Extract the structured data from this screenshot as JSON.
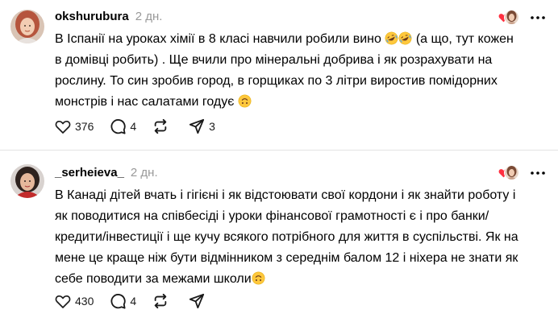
{
  "posts": [
    {
      "username": "okshurubura",
      "time": "2 дн.",
      "lines": [
        "В Іспанії на уроках хімії в 8 класі навчили робили вино",
        "(а що, тут кожен",
        "в домівці робить) . Ще вчили про мінеральні добрива і як розрахувати на",
        "рослину. То син зробив город, в горщиках по 3 літри виростив помідорних",
        "монстрів і нас салатами годує"
      ],
      "likes": "376",
      "replies": "4",
      "reposts": "",
      "shares": "3",
      "icons": {
        "avatar": "avatar-red-hair",
        "like": "heart-outline-icon",
        "reply": "speech-bubble-icon",
        "repost": "repost-arrows-icon",
        "share": "paper-plane-icon",
        "more": "more-horizontal-icon",
        "emoji_laugh": "rolling-on-floor-laughing-emoji",
        "emoji_upside": "upside-down-face-emoji"
      }
    },
    {
      "username": "_serheieva_",
      "time": "2 дн.",
      "lines": [
        "В Канаді дітей вчать і гігієні і як відстоювати свої кордони і як знайти роботу і",
        "як поводитися на співбесіді і уроки фінансової грамотності є і про банки/",
        "кредити/інвестиції і ще кучу всякого потрібного для життя в суспільстві. Як на",
        "мене це краще ніж бути відмінником з середнім балом 12 і ніхера не знати як",
        "себе поводити за межами школи"
      ],
      "likes": "430",
      "replies": "4",
      "reposts": "",
      "shares": "",
      "icons": {
        "avatar": "avatar-dark-hair",
        "like": "heart-outline-icon",
        "reply": "speech-bubble-icon",
        "repost": "repost-arrows-icon",
        "share": "paper-plane-icon",
        "more": "more-horizontal-icon",
        "emoji_upside": "upside-down-face-emoji"
      }
    }
  ],
  "colors": {
    "liked_heart": "#ff3040",
    "muted": "#999999",
    "divider": "#e3e3e3",
    "emoji_yellow": "#ffc83d"
  }
}
